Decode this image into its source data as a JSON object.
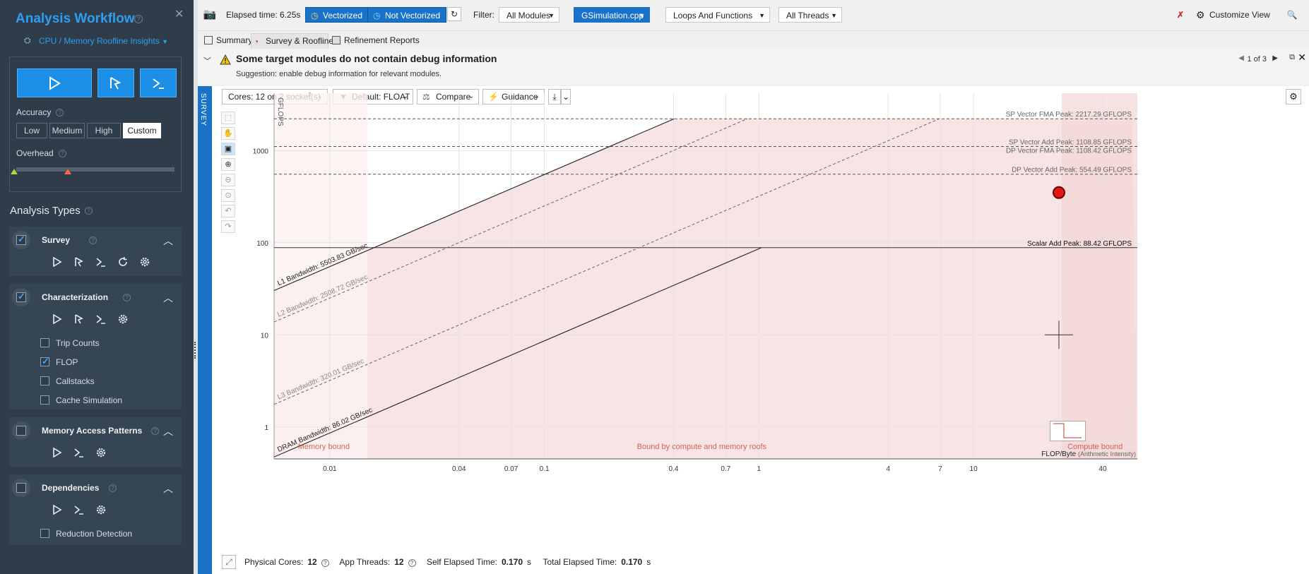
{
  "sidebar": {
    "title": "Analysis Workflow",
    "subtitle": "CPU / Memory Roofline Insights",
    "accuracy_label": "Accuracy",
    "accuracy_options": [
      "Low",
      "Medium",
      "High",
      "Custom"
    ],
    "accuracy_selected": "Custom",
    "overhead_label": "Overhead",
    "analysis_types_label": "Analysis Types",
    "cards": [
      {
        "name": "Survey",
        "checked": true
      },
      {
        "name": "Characterization",
        "checked": true,
        "options": [
          {
            "label": "Trip Counts",
            "checked": false
          },
          {
            "label": "FLOP",
            "checked": true
          },
          {
            "label": "Callstacks",
            "checked": false
          },
          {
            "label": "Cache Simulation",
            "checked": false
          }
        ]
      },
      {
        "name": "Memory Access Patterns",
        "checked": false
      },
      {
        "name": "Dependencies",
        "checked": false,
        "options": [
          {
            "label": "Reduction Detection",
            "checked": false
          }
        ]
      }
    ]
  },
  "toolbar": {
    "elapsed": "Elapsed time: 6.25s",
    "vectorized": "Vectorized",
    "not_vectorized": "Not Vectorized",
    "filter_label": "Filter:",
    "modules": "All Modules",
    "source": "GSimulation.cpp",
    "loops": "Loops And Functions",
    "threads": "All Threads",
    "customize": "Customize View"
  },
  "tabs": [
    "Summary",
    "Survey & Roofline",
    "Refinement Reports"
  ],
  "active_tab": "Survey & Roofline",
  "warning": {
    "title": "Some target modules do not contain debug information",
    "suggestion": "Suggestion: enable debug information for relevant modules.",
    "counter": "1 of 3"
  },
  "chart_controls": {
    "survey_label": "SURVEY",
    "cores": "Cores:  12 on 2 socket(s)",
    "precision": "Default: FLOAT",
    "compare": "Compare",
    "guidance": "Guidance"
  },
  "chart_data": {
    "type": "scatter",
    "xlabel": "FLOP/Byte",
    "xlabel_suffix": "(Arithmetic Intensity)",
    "ylabel": "GFLOPS",
    "x_scale": "log",
    "y_scale": "log",
    "xlim": [
      0.0055,
      58
    ],
    "ylim": [
      0.45,
      4200
    ],
    "x_ticks": [
      0.01,
      0.04,
      0.07,
      0.1,
      0.4,
      0.7,
      1,
      4,
      7,
      10,
      40
    ],
    "x_tick_labels": [
      "0.01",
      "0.04",
      "0.07",
      "0.1",
      "0.4",
      "0.7",
      "1",
      "4",
      "7",
      "10",
      "40"
    ],
    "y_ticks": [
      1,
      10,
      100,
      1000
    ],
    "y_tick_labels": [
      "1",
      "10",
      "100",
      "1000"
    ],
    "compute_roofs": [
      {
        "label": "SP Vector FMA Peak: 2217.29 GFLOPS",
        "value": 2217.29
      },
      {
        "label": "SP Vector Add Peak: 1108.85 GFLOPS",
        "value": 1108.85
      },
      {
        "label": "DP Vector FMA Peak: 1108.42 GFLOPS",
        "value": 1108.42
      },
      {
        "label": "DP Vector Add Peak: 554.49 GFLOPS",
        "value": 554.49
      },
      {
        "label": "Scalar Add Peak: 88.42 GFLOPS",
        "value": 88.42
      }
    ],
    "memory_roofs": [
      {
        "label": "L1 Bandwidth: 5503.83 GB/sec",
        "value": 5503.83
      },
      {
        "label": "L2 Bandwidth: 2508.72 GB/sec",
        "value": 2508.72
      },
      {
        "label": "L3 Bandwidth: 320.01 GB/sec",
        "value": 320.01
      },
      {
        "label": "DRAM Bandwidth: 86.02 GB/sec",
        "value": 86.02
      }
    ],
    "points": [
      {
        "x": 25,
        "y": 350
      }
    ],
    "regions": [
      "Memory bound",
      "Bound by compute and memory roofs",
      "Compute bound"
    ]
  },
  "footer": {
    "physical_cores_label": "Physical Cores:",
    "physical_cores": "12",
    "app_threads_label": "App Threads:",
    "app_threads": "12",
    "self_elapsed_label": "Self Elapsed Time:",
    "self_elapsed": "0.170",
    "total_elapsed_label": "Total Elapsed Time:",
    "total_elapsed": "0.170",
    "unit": "s"
  }
}
